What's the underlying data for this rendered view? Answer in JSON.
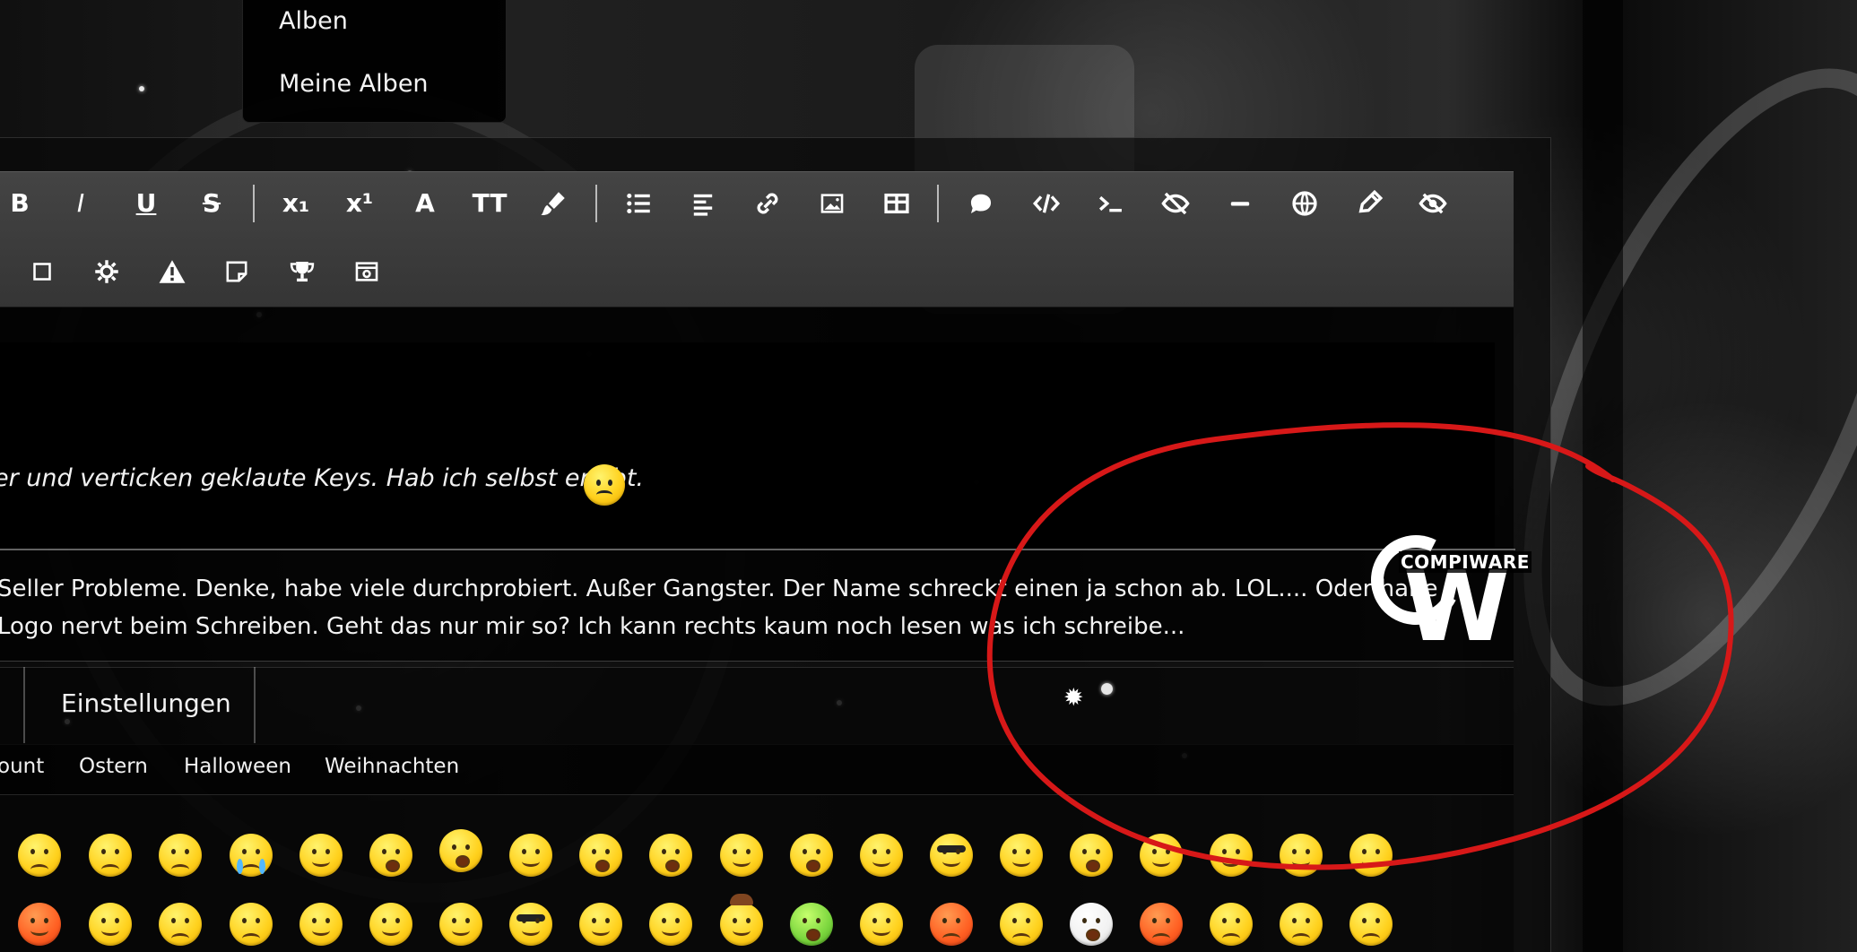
{
  "menu": {
    "items": [
      {
        "label": "Alben"
      },
      {
        "label": "Meine Alben"
      }
    ]
  },
  "toolbar": {
    "row1": [
      {
        "name": "bold-button",
        "icon": "bold-icon",
        "text": "B"
      },
      {
        "name": "italic-button",
        "icon": "italic-icon",
        "text": "I"
      },
      {
        "name": "underline-button",
        "icon": "underline-icon",
        "text": "U"
      },
      {
        "name": "strikethrough-button",
        "icon": "strikethrough-icon",
        "text": "S"
      },
      {
        "name": "subscript-button",
        "icon": "subscript-icon",
        "text": "x₁"
      },
      {
        "name": "superscript-button",
        "icon": "superscript-icon",
        "text": "x¹"
      },
      {
        "name": "font-button",
        "icon": "font-icon",
        "text": "A"
      },
      {
        "name": "font-size-button",
        "icon": "font-size-icon",
        "text": "TT"
      },
      {
        "name": "paint-button",
        "icon": "brush-icon",
        "text": ""
      },
      {
        "name": "list-button",
        "icon": "list-icon",
        "text": ""
      },
      {
        "name": "align-button",
        "icon": "align-left-icon",
        "text": ""
      },
      {
        "name": "link-button",
        "icon": "link-icon",
        "text": ""
      },
      {
        "name": "image-button",
        "icon": "image-icon",
        "text": ""
      },
      {
        "name": "table-button",
        "icon": "table-icon",
        "text": ""
      },
      {
        "name": "quote-button",
        "icon": "comment-icon",
        "text": ""
      },
      {
        "name": "code-button",
        "icon": "code-icon",
        "text": ""
      },
      {
        "name": "terminal-button",
        "icon": "terminal-icon",
        "text": ""
      },
      {
        "name": "spoiler-button",
        "icon": "eye-slash-icon",
        "text": ""
      },
      {
        "name": "horizontal-rule-button",
        "icon": "minus-icon",
        "text": ""
      },
      {
        "name": "language-button",
        "icon": "globe-icon",
        "text": ""
      },
      {
        "name": "edit-button",
        "icon": "pencil-icon",
        "text": ""
      },
      {
        "name": "hide-button",
        "icon": "hidden-eye-icon",
        "text": ""
      }
    ],
    "row2": [
      {
        "name": "box-button",
        "icon": "square-icon"
      },
      {
        "name": "settings-button",
        "icon": "gear-icon"
      },
      {
        "name": "warning-button",
        "icon": "warning-icon"
      },
      {
        "name": "note-button",
        "icon": "sticky-note-icon"
      },
      {
        "name": "award-button",
        "icon": "trophy-icon"
      },
      {
        "name": "media-button",
        "icon": "media-icon"
      }
    ]
  },
  "editor": {
    "quote_text": "er und verticken geklaute Keys. Hab ich selbst erlebt.",
    "lines": [
      "Seller Probleme. Denke, habe viele durchprobiert. Außer Gangster. Der Name schreckt einen ja schon ab. LOL.... Oder habe",
      " Logo nervt beim Schreiben. Geht das nur mir so? Ich kann rechts kaum noch lesen was ich schreibe..."
    ],
    "logo": {
      "letters": "CW",
      "text": "COMPIWARE"
    }
  },
  "tabs": {
    "settings": "Einstellungen"
  },
  "categories": [
    "ount",
    "Ostern",
    "Halloween",
    "Weihnachten"
  ],
  "emoji": {
    "palette": {
      "yellow": "#ffd11d",
      "red": "#ff5f22",
      "green": "#7ad53d",
      "white": "#f1f1f1"
    },
    "row1": [
      "grimace",
      "disappointed",
      "sad",
      "crying",
      "grin",
      "laughing",
      "beaming",
      "smile",
      "rolling-laugh",
      "star-struck",
      "winking-tongue",
      "zany",
      "slight-smile",
      "cool",
      "smirk",
      "surprised",
      "relieved",
      "neutral",
      "sly",
      "wink"
    ],
    "row2": [
      "hearts",
      "hug",
      "sleepy",
      "sleeping",
      "thinking",
      "slight-smile",
      "rolling-eyes",
      "nerd",
      "monocle",
      "flat",
      "cowboy",
      "sick",
      "party",
      "frown",
      "weary",
      "exploding-head",
      "cursing",
      "tired",
      "confused",
      "angry"
    ]
  },
  "markers": {
    "gear": "✹"
  },
  "annotation": {
    "color": "#d71818"
  }
}
